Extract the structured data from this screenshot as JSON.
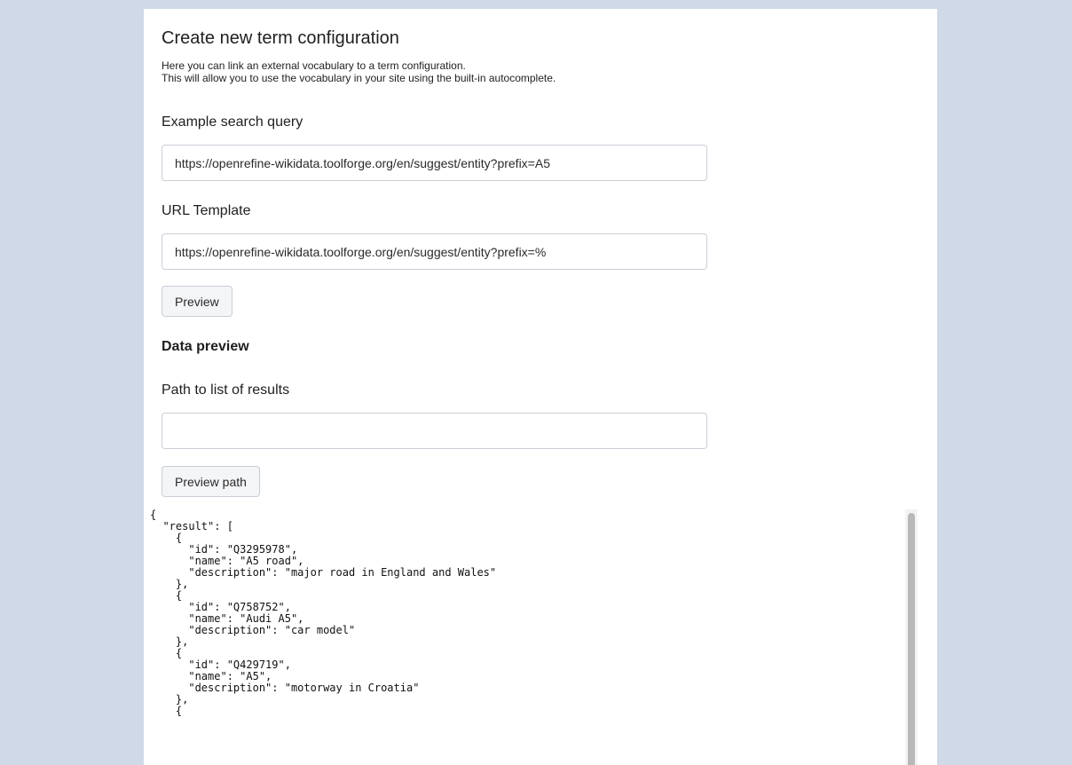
{
  "form": {
    "title": "Create new term configuration",
    "intro_line1": "Here you can link an external vocabulary to a term configuration.",
    "intro_line2": "This will allow you to use the vocabulary in your site using the built-in autocomplete.",
    "example_query": {
      "label": "Example search query",
      "value": "https://openrefine-wikidata.toolforge.org/en/suggest/entity?prefix=A5"
    },
    "url_template": {
      "label": "URL Template",
      "value": "https://openrefine-wikidata.toolforge.org/en/suggest/entity?prefix=%"
    },
    "preview_button": "Preview",
    "data_preview_heading": "Data preview",
    "results_path": {
      "label": "Path to list of results",
      "value": ""
    },
    "preview_path_button": "Preview path"
  },
  "preview": {
    "json_text": "{\n  \"result\": [\n    {\n      \"id\": \"Q3295978\",\n      \"name\": \"A5 road\",\n      \"description\": \"major road in England and Wales\"\n    },\n    {\n      \"id\": \"Q758752\",\n      \"name\": \"Audi A5\",\n      \"description\": \"car model\"\n    },\n    {\n      \"id\": \"Q429719\",\n      \"name\": \"A5\",\n      \"description\": \"motorway in Croatia\"\n    },\n    {"
  },
  "colors": {
    "page_background": "#cfd9e8",
    "panel_background": "#ffffff",
    "input_border": "#c9ced6",
    "button_background": "#f4f5f7",
    "scrollbar_thumb": "#b8b8b8"
  }
}
